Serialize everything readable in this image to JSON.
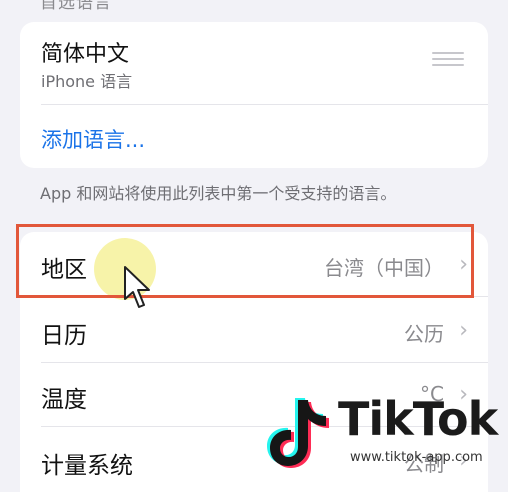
{
  "section_header": "首选语言",
  "language": {
    "title": "简体中文",
    "subtitle": "iPhone 语言",
    "reorder_icon": "reorder-icon",
    "add_label": "添加语言..."
  },
  "footnote": "App 和网站将使用此列表中第一个受支持的语言。",
  "settings": [
    {
      "label": "地区",
      "value": "台湾（中国）"
    },
    {
      "label": "日历",
      "value": "公历"
    },
    {
      "label": "温度",
      "value": "°C"
    },
    {
      "label": "计量系统",
      "value": "公制"
    }
  ],
  "watermark": {
    "text": "TikTok",
    "url": "www.tiktok-app.com"
  },
  "colors": {
    "accent": "#1a73e8",
    "highlight": "#e2573a",
    "background": "#f2f2f7"
  }
}
